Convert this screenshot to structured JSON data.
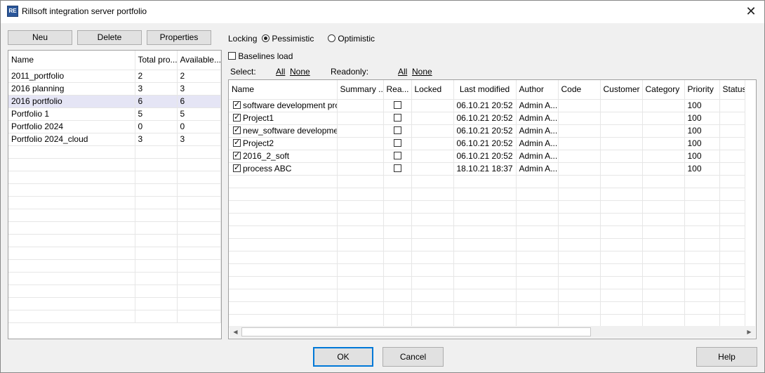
{
  "window": {
    "title": "Rillsoft integration server portfolio",
    "icon": "rillsoft-app-icon"
  },
  "toolbar": {
    "new_label": "Neu",
    "delete_label": "Delete",
    "properties_label": "Properties"
  },
  "locking": {
    "label": "Locking",
    "pessimistic": "Pessimistic",
    "optimistic": "Optimistic",
    "selected": "Pessimistic"
  },
  "baselines": {
    "label": "Baselines load",
    "checked": false
  },
  "select": {
    "label": "Select:",
    "all": "All",
    "none": "None"
  },
  "readonly": {
    "label": "Readonly:",
    "all": "All",
    "none": "None"
  },
  "portfolio_table": {
    "columns": [
      "Name",
      "Total pro...",
      "Available..."
    ],
    "rows": [
      {
        "name": "2011_portfolio",
        "total": "2",
        "available": "2"
      },
      {
        "name": "2016 planning",
        "total": "3",
        "available": "3"
      },
      {
        "name": "2016 portfolio",
        "total": "6",
        "available": "6",
        "selected": true
      },
      {
        "name": "Portfolio 1",
        "total": "5",
        "available": "5"
      },
      {
        "name": "Portfolio 2024",
        "total": "0",
        "available": "0"
      },
      {
        "name": "Portfolio 2024_cloud",
        "total": "3",
        "available": "3"
      }
    ]
  },
  "project_table": {
    "columns": [
      "Name",
      "Summary ...",
      "Rea...",
      "Locked",
      "Last modified",
      "Author",
      "Code",
      "Customer",
      "Category",
      "Priority",
      "Status"
    ],
    "rows": [
      {
        "name": "software development process",
        "checked": true,
        "readonly": false,
        "modified": "06.10.21 20:52",
        "author": "Admin A...",
        "priority": "100"
      },
      {
        "name": "Project1",
        "checked": true,
        "readonly": false,
        "modified": "06.10.21 20:52",
        "author": "Admin A...",
        "priority": "100"
      },
      {
        "name": "new_software development process",
        "checked": true,
        "readonly": false,
        "modified": "06.10.21 20:52",
        "author": "Admin A...",
        "priority": "100"
      },
      {
        "name": "Project2",
        "checked": true,
        "readonly": false,
        "modified": "06.10.21 20:52",
        "author": "Admin A...",
        "priority": "100"
      },
      {
        "name": "2016_2_soft",
        "checked": true,
        "readonly": false,
        "modified": "06.10.21 20:52",
        "author": "Admin A...",
        "priority": "100"
      },
      {
        "name": "process ABC",
        "checked": true,
        "readonly": false,
        "modified": "18.10.21 18:37",
        "author": "Admin A...",
        "priority": "100"
      }
    ]
  },
  "footer": {
    "ok_label": "OK",
    "cancel_label": "Cancel",
    "help_label": "Help"
  }
}
